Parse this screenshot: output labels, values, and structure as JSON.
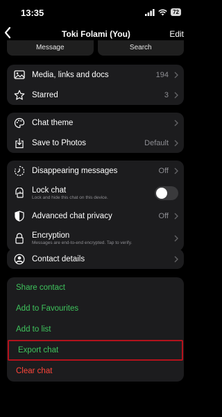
{
  "status": {
    "time": "13:35",
    "battery": "72"
  },
  "nav": {
    "back_icon": "chevron-left-icon",
    "title": "Toki Folami (You)",
    "edit": "Edit"
  },
  "quick_actions": {
    "message": "Message",
    "search": "Search"
  },
  "media_group": {
    "media": {
      "label": "Media, links and docs",
      "value": "194",
      "icon": "photo-icon"
    },
    "starred": {
      "label": "Starred",
      "value": "3",
      "icon": "star-icon"
    }
  },
  "theme_group": {
    "chat_theme": {
      "label": "Chat theme",
      "icon": "palette-icon"
    },
    "save_photos": {
      "label": "Save to Photos",
      "value": "Default",
      "icon": "download-icon"
    }
  },
  "privacy_group": {
    "disappearing": {
      "label": "Disappearing messages",
      "value": "Off",
      "icon": "timer-icon"
    },
    "lock_chat": {
      "label": "Lock chat",
      "sub": "Lock and hide this chat on this device.",
      "icon": "lock-chat-icon",
      "enabled": false
    },
    "advanced_privacy": {
      "label": "Advanced chat privacy",
      "value": "Off",
      "icon": "shield-icon"
    },
    "encryption": {
      "label": "Encryption",
      "sub": "Messages are end-to-end encrypted. Tap to verify.",
      "icon": "lock-icon"
    }
  },
  "contact_group": {
    "contact_details": {
      "label": "Contact details",
      "icon": "person-icon"
    }
  },
  "actions": {
    "share_contact": "Share contact",
    "add_favourites": "Add to Favourites",
    "add_list": "Add to list",
    "export_chat": "Export chat",
    "clear_chat": "Clear chat"
  },
  "colors": {
    "green": "#3ec35c",
    "red": "#ff453a",
    "highlight": "#b3121c",
    "group_bg": "#1c1c1e"
  }
}
